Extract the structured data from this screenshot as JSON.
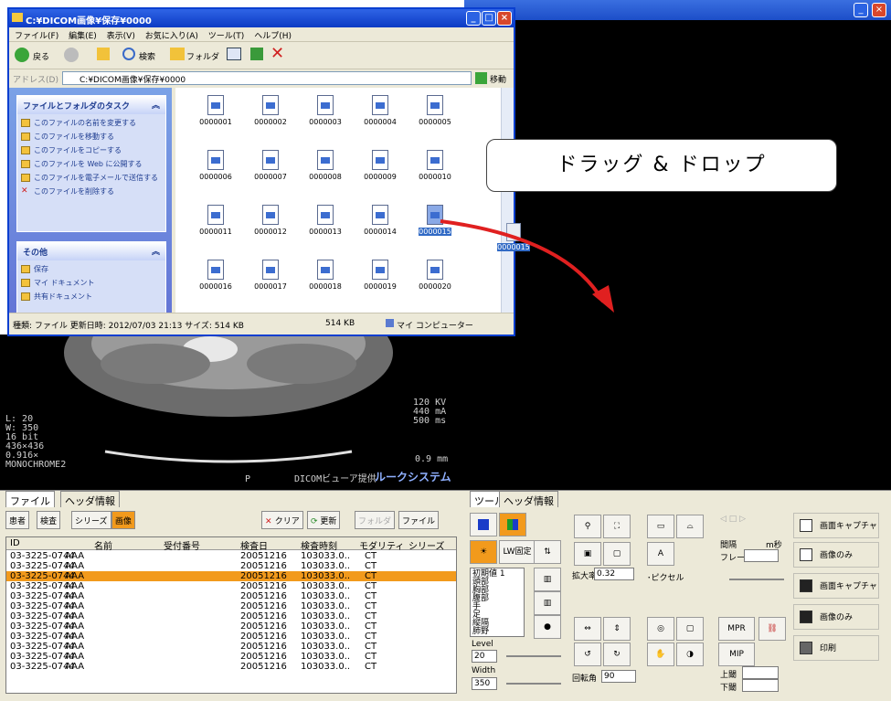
{
  "explorer": {
    "title": "C:¥DICOM画像¥保存¥0000",
    "menu": [
      "ファイル(F)",
      "編集(E)",
      "表示(V)",
      "お気に入り(A)",
      "ツール(T)",
      "ヘルプ(H)"
    ],
    "toolbar": {
      "back": "戻る",
      "search": "検索",
      "folder": "フォルダ"
    },
    "address_label": "アドレス(D)",
    "address_value": "C:¥DICOM画像¥保存¥0000",
    "go_label": "移動",
    "tasks": {
      "header": "ファイルとフォルダのタスク",
      "items": [
        "このファイルの名前を変更する",
        "このファイルを移動する",
        "このファイルをコピーする",
        "このファイルを Web に公開する",
        "このファイルを電子メールで送信する",
        "このファイルを削除する"
      ]
    },
    "other": {
      "header": "その他",
      "items": [
        "保存",
        "マイ ドキュメント",
        "共有ドキュメント"
      ]
    },
    "files": [
      "0000001",
      "0000002",
      "0000003",
      "0000004",
      "0000005",
      "0000006",
      "0000007",
      "0000008",
      "0000009",
      "0000010",
      "0000011",
      "0000012",
      "0000013",
      "0000014",
      "0000015",
      "0000016",
      "0000017",
      "0000018",
      "0000019",
      "0000020"
    ],
    "selected_file": "0000015",
    "status_left": "種類: ファイル 更新日時: 2012/07/03 21:13 サイズ: 514 KB",
    "status_size": "514 KB",
    "status_loc": "マイ コンピューター"
  },
  "drag_ghost_label": "0000015",
  "callout_text": "ドラッグ & ドロップ",
  "viewer": {
    "left_info": [
      "L: 20",
      "W: 350",
      "16 bit",
      "436×436",
      "0.916×",
      "MONOCHROME2"
    ],
    "right_info": [
      "120 KV",
      "440 mA",
      "500 ms"
    ],
    "thickness": "0.9 mm",
    "orientation": "P",
    "footer": "DICOMビューア提供",
    "brand": "ルークシステム"
  },
  "left_panel": {
    "tabs": [
      "ファイル",
      "ヘッダ情報"
    ],
    "buttons": [
      "患者",
      "検査",
      "シリーズ",
      "画像",
      "クリア",
      "更新",
      "フォルダ",
      "ファイル"
    ],
    "columns": [
      "ID",
      "名前",
      "受付番号",
      "検査日",
      "検査時刻",
      "モダリティ",
      "シリーズ"
    ],
    "rows": [
      [
        "03-3225-0744",
        "AAA",
        "",
        "20051216",
        "103033.0..",
        "CT"
      ],
      [
        "03-3225-0744",
        "AAA",
        "",
        "20051216",
        "103033.0..",
        "CT"
      ],
      [
        "03-3225-0744",
        "AAA",
        "",
        "20051216",
        "103033.0..",
        "CT"
      ],
      [
        "03-3225-0744",
        "AAA",
        "",
        "20051216",
        "103033.0..",
        "CT"
      ],
      [
        "03-3225-0744",
        "AAA",
        "",
        "20051216",
        "103033.0..",
        "CT"
      ],
      [
        "03-3225-0744",
        "AAA",
        "",
        "20051216",
        "103033.0..",
        "CT"
      ],
      [
        "03-3225-0744",
        "AAA",
        "",
        "20051216",
        "103033.0..",
        "CT"
      ],
      [
        "03-3225-0744",
        "AAA",
        "",
        "20051216",
        "103033.0..",
        "CT"
      ],
      [
        "03-3225-0744",
        "AAA",
        "",
        "20051216",
        "103033.0..",
        "CT"
      ],
      [
        "03-3225-0744",
        "AAA",
        "",
        "20051216",
        "103033.0..",
        "CT"
      ],
      [
        "03-3225-0744",
        "AAA",
        "",
        "20051216",
        "103033.0..",
        "CT"
      ],
      [
        "03-3225-0744",
        "AAA",
        "",
        "20051216",
        "103033.0..",
        "CT"
      ]
    ],
    "selected_row": 2
  },
  "right_panel": {
    "tabs": [
      "ツール",
      "ヘッダ情報"
    ],
    "lw_fixed": "LW固定",
    "presets": [
      "初期値 1",
      "頭部",
      "胸部",
      "腹部",
      "手",
      "足",
      "縦隔",
      "肺野"
    ],
    "level_label": "Level",
    "level_value": "20",
    "width_label": "Width",
    "width_value": "350",
    "zoom_label": "拡大率",
    "zoom_value": "0.32",
    "pixel_label": "･ピクセル",
    "rotate_label": "回転角",
    "rotate_value": "90",
    "interval_label": "間隔",
    "interval_unit": "m秒",
    "frame_label": "フレーム",
    "mpr": "MPR",
    "mip": "MIP",
    "upper_label": "上閾",
    "lower_label": "下閾",
    "actions": [
      "画面キャプチャ",
      "画像のみ",
      "画面キャプチャ",
      "画像のみ",
      "印刷"
    ]
  },
  "colors": {
    "selected_row": "#f29a1c",
    "xp_title": "#1c4ec8",
    "arrow": "#e02020"
  }
}
